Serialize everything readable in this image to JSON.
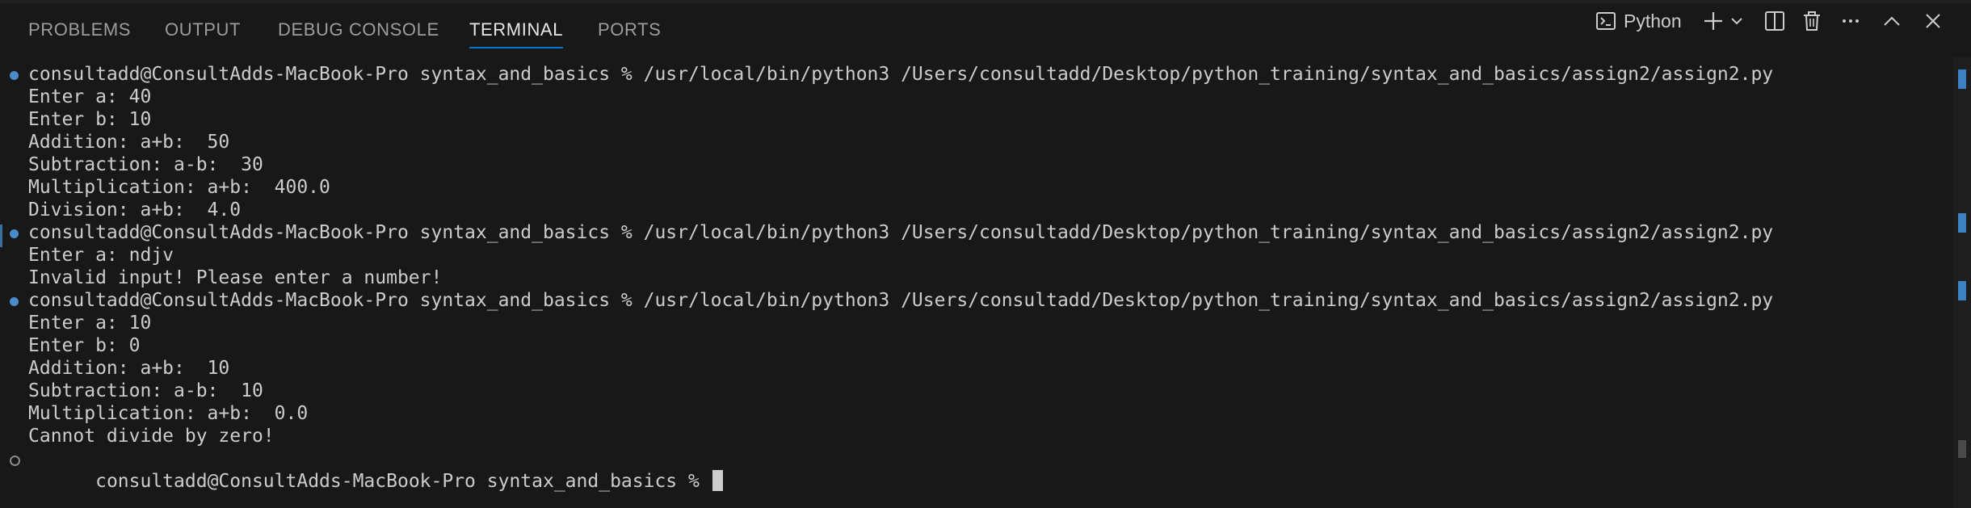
{
  "tabs": [
    {
      "label": "PROBLEMS"
    },
    {
      "label": "OUTPUT"
    },
    {
      "label": "DEBUG CONSOLE"
    },
    {
      "label": "TERMINAL"
    },
    {
      "label": "PORTS"
    }
  ],
  "active_tab": "TERMINAL",
  "toolbar": {
    "profile_label": "Python",
    "icons": [
      "terminal-icon",
      "plus-icon",
      "chevron-down-icon",
      "split-icon",
      "trash-icon",
      "more-icon",
      "maximize-icon",
      "close-icon"
    ]
  },
  "colors": {
    "background": "#181818",
    "accent": "#0078d4",
    "decoration_success": "#4a8cc9",
    "text": "#cccccc"
  },
  "terminal": {
    "prompt": "consultadd@ConsultAdds-MacBook-Pro syntax_and_basics % ",
    "command": "/usr/local/bin/python3 /Users/consultadd/Desktop/python_training/syntax_and_basics/assign2/assign2.py",
    "lines": [
      {
        "kind": "prompt",
        "decoration": "done",
        "text": "consultadd@ConsultAdds-MacBook-Pro syntax_and_basics % /usr/local/bin/python3 /Users/consultadd/Desktop/python_training/syntax_and_basics/assign2/assign2.py"
      },
      {
        "kind": "output",
        "text": "Enter a: 40"
      },
      {
        "kind": "output",
        "text": "Enter b: 10"
      },
      {
        "kind": "output",
        "text": "Addition: a+b:  50"
      },
      {
        "kind": "output",
        "text": "Subtraction: a-b:  30"
      },
      {
        "kind": "output",
        "text": "Multiplication: a+b:  400.0"
      },
      {
        "kind": "output",
        "text": "Division: a+b:  4.0"
      },
      {
        "kind": "prompt",
        "decoration": "done",
        "text": "consultadd@ConsultAdds-MacBook-Pro syntax_and_basics % /usr/local/bin/python3 /Users/consultadd/Desktop/python_training/syntax_and_basics/assign2/assign2.py"
      },
      {
        "kind": "output",
        "text": "Enter a: ndjv"
      },
      {
        "kind": "output",
        "text": "Invalid input! Please enter a number!"
      },
      {
        "kind": "prompt",
        "decoration": "done",
        "text": "consultadd@ConsultAdds-MacBook-Pro syntax_and_basics % /usr/local/bin/python3 /Users/consultadd/Desktop/python_training/syntax_and_basics/assign2/assign2.py"
      },
      {
        "kind": "output",
        "text": "Enter a: 10"
      },
      {
        "kind": "output",
        "text": "Enter b: 0"
      },
      {
        "kind": "output",
        "text": "Addition: a+b:  10"
      },
      {
        "kind": "output",
        "text": "Subtraction: a-b:  10"
      },
      {
        "kind": "output",
        "text": "Multiplication: a+b:  0.0"
      },
      {
        "kind": "output",
        "text": "Cannot divide by zero!"
      },
      {
        "kind": "prompt",
        "decoration": "idle",
        "text": "consultadd@ConsultAdds-MacBook-Pro syntax_and_basics % ",
        "cursor": true
      }
    ]
  }
}
